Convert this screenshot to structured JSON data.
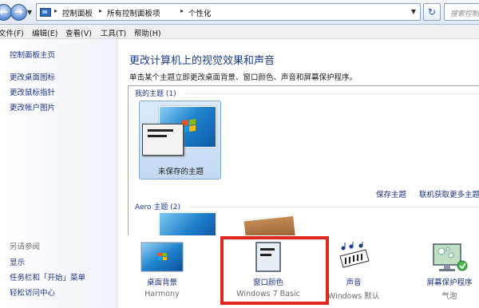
{
  "address": {
    "breadcrumbs": [
      "控制面板",
      "所有控制面板项",
      "个性化"
    ],
    "search_placeholder": "搜索控制面板"
  },
  "menu": [
    "文件(F)",
    "编辑(E)",
    "查看(V)",
    "工具(T)",
    "帮助(H)"
  ],
  "sidebar": {
    "links": [
      "控制面板主页",
      "更改桌面图标",
      "更改鼠标指针",
      "更改帐户图片"
    ],
    "see_also_title": "另请参阅",
    "see_also": [
      "显示",
      "任务栏和「开始」菜单",
      "轻松访问中心"
    ]
  },
  "main": {
    "heading": "更改计算机上的视觉效果和声音",
    "subtitle": "单击某个主题立即更改桌面背景、窗口颜色、声音和屏幕保护程序。",
    "my_themes_label": "我的主题 (1)",
    "unsaved_theme": "未保存的主题",
    "save_theme": "保存主题",
    "get_more_themes": "联机获取更多主题",
    "aero_label": "Aero 主题 (2)"
  },
  "bottom": [
    {
      "label": "桌面背景",
      "value": "Harmony",
      "icon": "desktop-background-icon"
    },
    {
      "label": "窗口颜色",
      "value": "Windows 7 Basic",
      "icon": "window-color-icon"
    },
    {
      "label": "声音",
      "value": "Windows 默认",
      "icon": "sound-icon"
    },
    {
      "label": "屏幕保护程序",
      "value": "气泡",
      "icon": "screensaver-icon"
    }
  ],
  "colors": {
    "highlight": "#e0271f",
    "link": "#1e3287",
    "heading": "#1e3c8a"
  }
}
